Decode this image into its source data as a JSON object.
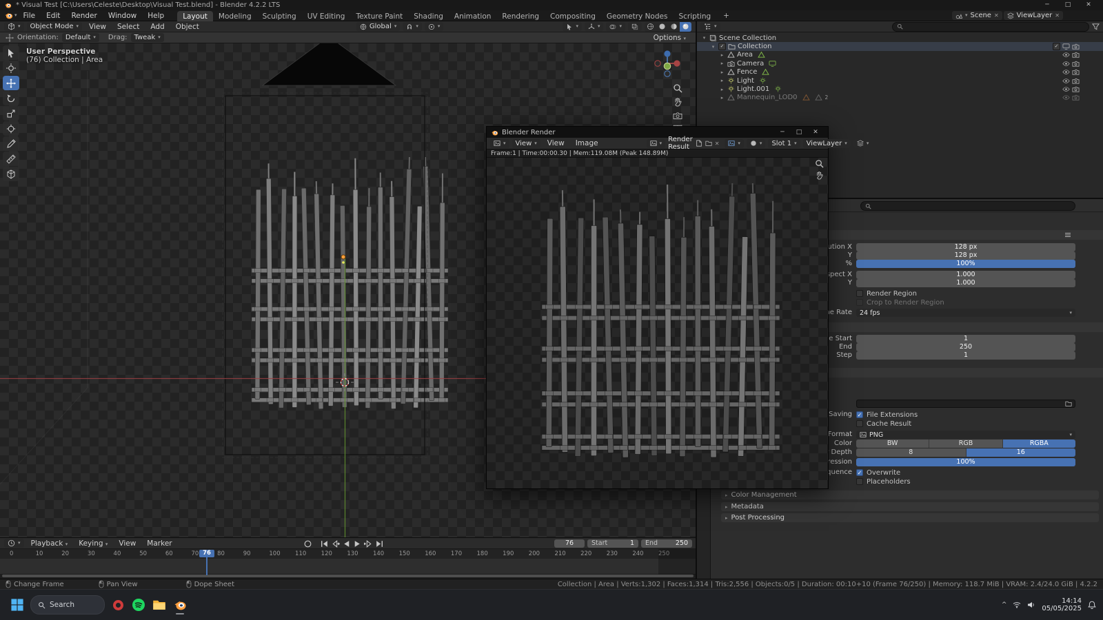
{
  "titlebar": {
    "title": "* Visual Test [C:\\Users\\Celeste\\Desktop\\Visual Test.blend] - Blender 4.2.2 LTS"
  },
  "topbar": {
    "menus": [
      "File",
      "Edit",
      "Render",
      "Window",
      "Help"
    ],
    "workspaces": [
      "Layout",
      "Modeling",
      "Sculpting",
      "UV Editing",
      "Texture Paint",
      "Shading",
      "Animation",
      "Rendering",
      "Compositing",
      "Geometry Nodes",
      "Scripting"
    ],
    "active_workspace": "Layout",
    "add_workspace_label": "+",
    "scene_name": "Scene",
    "viewlayer_name": "ViewLayer"
  },
  "viewport": {
    "header": {
      "mode": "Object Mode",
      "menus": [
        "View",
        "Select",
        "Add",
        "Object"
      ],
      "orientation": "Global",
      "shading_modes": [
        "wireframe",
        "solid",
        "material",
        "rendered"
      ],
      "active_shading": "rendered"
    },
    "tool_settings": {
      "orientation_label": "Orientation:",
      "orientation_value": "Default",
      "drag_label": "Drag:",
      "drag_value": "Tweak",
      "options_label": "Options"
    },
    "toolbar": {
      "tools": [
        "select",
        "cursor",
        "move",
        "rotate",
        "scale",
        "transform",
        "annotate",
        "measure",
        "add-cube"
      ],
      "active": "move"
    },
    "overlay": {
      "line1": "User Perspective",
      "line2": "(76) Collection | Area"
    }
  },
  "render_window": {
    "title": "Blender Render",
    "mode": "View",
    "menus": [
      "View",
      "Image"
    ],
    "image_name": "Render Result",
    "slot": "Slot 1",
    "layer": "ViewLayer",
    "stats": "Frame:1 | Time:00:00.30 | Mem:119.08M (Peak 148.89M)"
  },
  "outliner": {
    "search_placeholder": "",
    "rows": [
      {
        "name": "Scene Collection",
        "level": 0,
        "type": "scene-collection",
        "expanded": true,
        "toggles": []
      },
      {
        "name": "Collection",
        "level": 1,
        "type": "collection",
        "expanded": true,
        "selected": true,
        "checkbox": true,
        "toggles": [
          "checkbox",
          "screen",
          "camera"
        ]
      },
      {
        "name": "Area",
        "level": 2,
        "type": "mesh",
        "data_icon": "mesh",
        "toggles": [
          "eye",
          "camera"
        ]
      },
      {
        "name": "Camera",
        "level": 2,
        "type": "camera",
        "data_icon": "screen",
        "toggles": [
          "eye",
          "camera"
        ]
      },
      {
        "name": "Fence",
        "level": 2,
        "type": "mesh",
        "data_icon": "mesh",
        "toggles": [
          "eye",
          "camera"
        ]
      },
      {
        "name": "Light",
        "level": 2,
        "type": "light",
        "data_icon": "light",
        "toggles": [
          "eye",
          "camera"
        ]
      },
      {
        "name": "Light.001",
        "level": 2,
        "type": "light",
        "data_icon": "light",
        "toggles": [
          "eye",
          "camera"
        ]
      },
      {
        "name": "Mannequin_LOD0",
        "level": 2,
        "type": "mesh",
        "dimmed": true,
        "trailing": [
          [
            "mesh",
            "#d2813c"
          ],
          [
            "mesh",
            "#9a9a9a"
          ]
        ],
        "count_badge": "2",
        "toggles": [
          "eye",
          "camera"
        ]
      }
    ]
  },
  "properties": {
    "search_placeholder": "",
    "format": {
      "resolution_x_label": "Resolution X",
      "resolution_x": "128 px",
      "resolution_y_label": "Y",
      "resolution_y": "128 px",
      "percent_label": "%",
      "percent": "100%",
      "percent_fill": "100%",
      "aspect_x_label": "Aspect X",
      "aspect_x": "1.000",
      "aspect_y_label": "Y",
      "aspect_y": "1.000",
      "render_region_label": "Render Region",
      "render_region_checked": false,
      "crop_label": "Crop to Render Region",
      "crop_checked": false,
      "frame_rate_label": "Frame Rate",
      "frame_rate": "24 fps"
    },
    "frame_range": {
      "start_label": "Frame Start",
      "start": "1",
      "end_label": "End",
      "end": "250",
      "step_label": "Step",
      "step": "1"
    },
    "output": {
      "saving_label": "Saving",
      "file_extensions_label": "File Extensions",
      "file_extensions_checked": true,
      "cache_label": "Cache Result",
      "cache_checked": false,
      "file_format_label": "File Format",
      "file_format": "PNG",
      "color_label": "Color",
      "color_options": [
        "BW",
        "RGB",
        "RGBA"
      ],
      "color_active": "RGBA",
      "depth_label": "Color Depth",
      "depth_options": [
        "8",
        "16"
      ],
      "depth_active": "16",
      "compression_label": "Compression",
      "compression": "100%",
      "compression_fill": "100%",
      "sequence_label": "Image Sequence",
      "overwrite_label": "Overwrite",
      "overwrite_checked": true,
      "placeholders_label": "Placeholders",
      "placeholders_checked": false
    },
    "sections": [
      "Color Management",
      "Metadata",
      "Post Processing"
    ]
  },
  "timeline": {
    "menus": [
      "Playback",
      "Keying",
      "View",
      "Marker"
    ],
    "current_frame": "76",
    "start_label": "Start",
    "start": "1",
    "end_label": "End",
    "end": "250",
    "tick_min": 0,
    "tick_max": 250,
    "tick_step": 10,
    "playhead": 76
  },
  "statusbar": {
    "hints": [
      "Change Frame",
      "Pan View",
      "Dope Sheet"
    ],
    "stats": "Collection | Area | Verts:1,302 | Faces:1,314 | Tris:2,556 | Objects:0/5 | Duration: 00:10+10 (Frame 76/250) | Memory: 118.7 MiB | VRAM: 2.4/24.0 GiB | 4.2.2"
  },
  "os": {
    "taskbar": {
      "search_label": "Search",
      "clock_time": "14:14",
      "clock_date": "05/05/2025"
    }
  },
  "colors": {
    "accent_blue": "#4772b3",
    "blender_orange": "#ff9f3f",
    "data_green": "#7fb648"
  }
}
